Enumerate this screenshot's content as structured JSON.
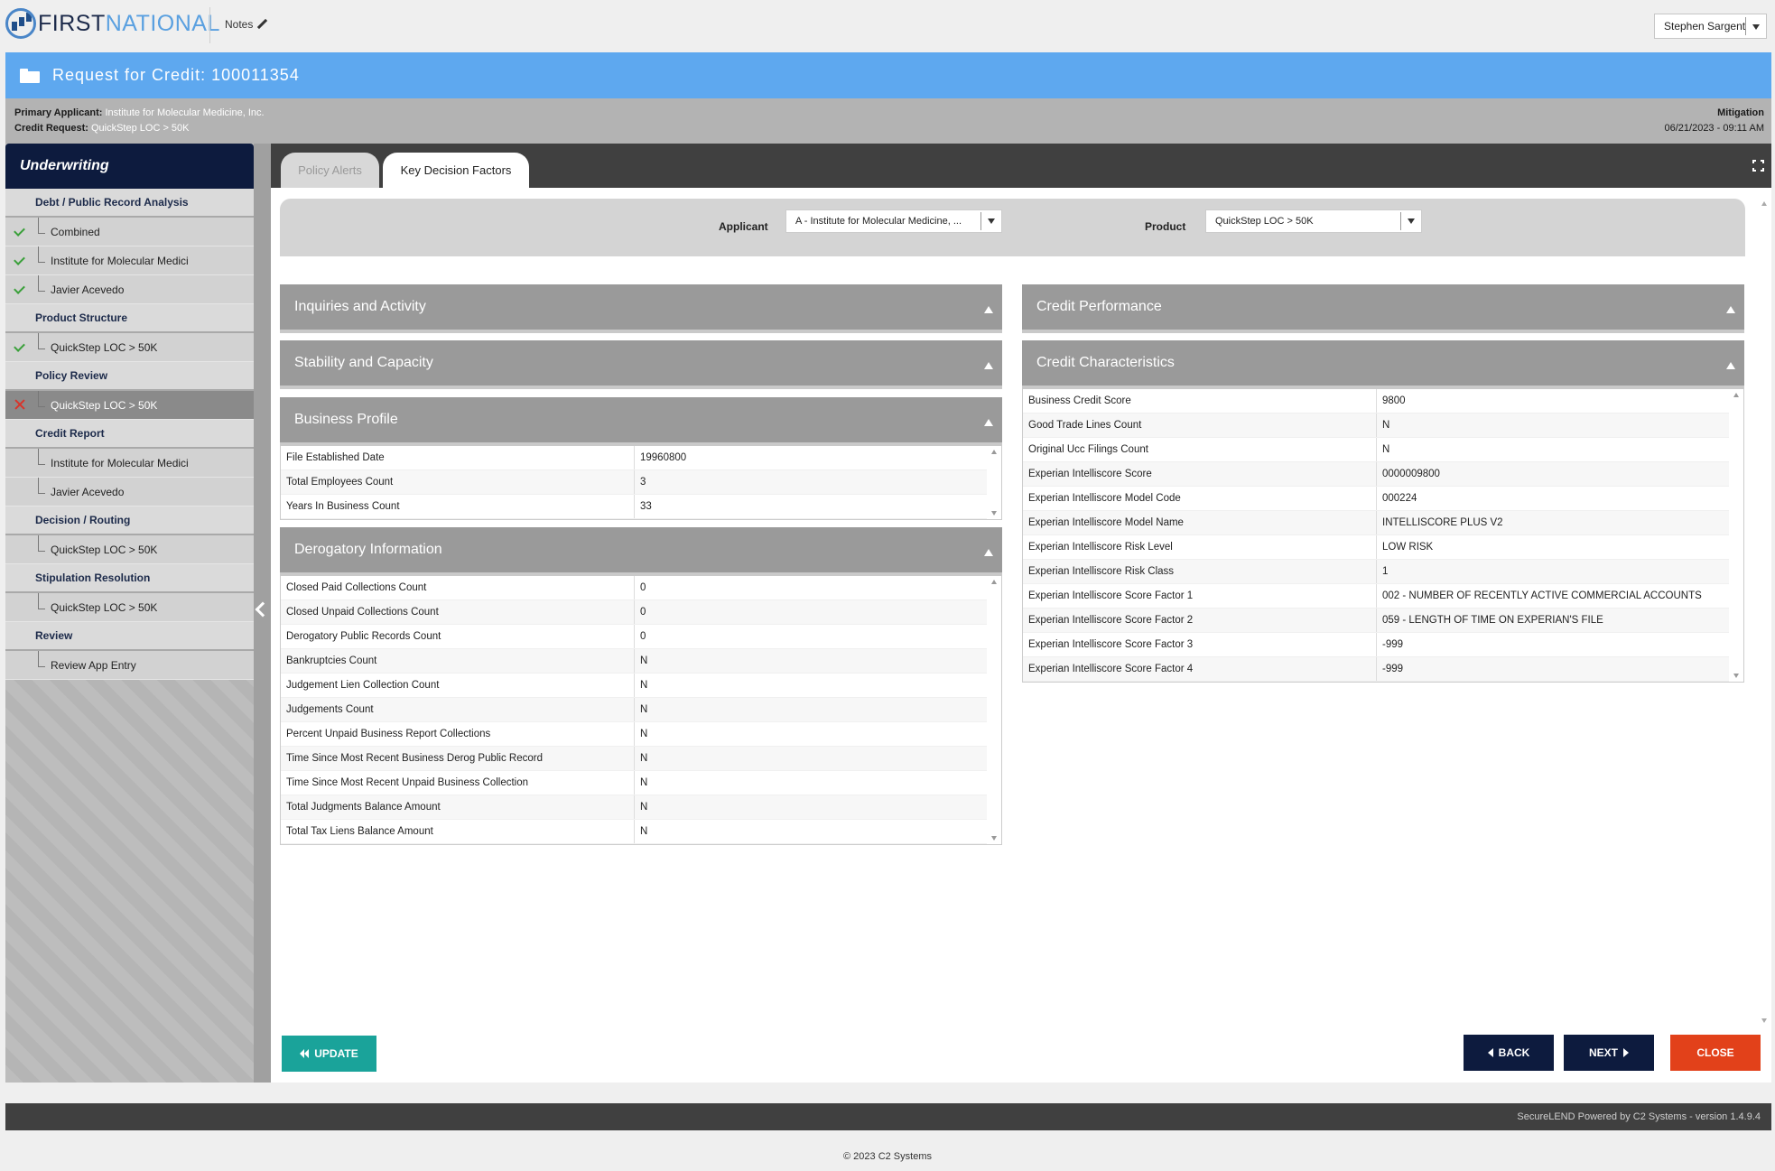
{
  "brand": {
    "first": "FIRST",
    "national": "NATIONAL"
  },
  "topbar": {
    "notes_label": "Notes",
    "user": "Stephen Sargent"
  },
  "title": "Request for Credit: 100011354",
  "info": {
    "primary_applicant_label": "Primary Applicant:",
    "primary_applicant_value": "Institute for Molecular Medicine, Inc.",
    "credit_request_label": "Credit Request:",
    "credit_request_value": "QuickStep LOC > 50K",
    "status": "Mitigation",
    "timestamp": "06/21/2023 - 09:11 AM"
  },
  "sidebar": {
    "title": "Underwriting",
    "sections": [
      {
        "label": "Debt / Public Record Analysis",
        "items": [
          {
            "label": "Combined",
            "status": "check"
          },
          {
            "label": "Institute for Molecular Medici",
            "status": "check"
          },
          {
            "label": "Javier Acevedo",
            "status": "check"
          }
        ]
      },
      {
        "label": "Product Structure",
        "items": [
          {
            "label": "QuickStep LOC > 50K",
            "status": "check"
          }
        ]
      },
      {
        "label": "Policy Review",
        "items": [
          {
            "label": "QuickStep LOC > 50K",
            "status": "x",
            "active": true
          }
        ]
      },
      {
        "label": "Credit Report",
        "items": [
          {
            "label": "Institute for Molecular Medici",
            "status": ""
          },
          {
            "label": "Javier Acevedo",
            "status": ""
          }
        ]
      },
      {
        "label": "Decision / Routing",
        "items": [
          {
            "label": "QuickStep LOC > 50K",
            "status": ""
          }
        ]
      },
      {
        "label": "Stipulation Resolution",
        "items": [
          {
            "label": "QuickStep LOC > 50K",
            "status": ""
          }
        ]
      },
      {
        "label": "Review",
        "items": [
          {
            "label": "Review App Entry",
            "status": ""
          }
        ]
      }
    ]
  },
  "tabs": {
    "policy_alerts": "Policy Alerts",
    "key_decision_factors": "Key Decision Factors"
  },
  "filters": {
    "applicant_label": "Applicant",
    "applicant_value": "A - Institute for Molecular Medicine, ...",
    "product_label": "Product",
    "product_value": "QuickStep LOC > 50K"
  },
  "sections": {
    "inquiries": "Inquiries and Activity",
    "stability": "Stability and Capacity",
    "business_profile": "Business Profile",
    "derogatory": "Derogatory Information",
    "credit_performance": "Credit Performance",
    "credit_characteristics": "Credit Characteristics"
  },
  "business_profile_rows": [
    {
      "k": "File Established Date",
      "v": "19960800"
    },
    {
      "k": "Total Employees Count",
      "v": "3"
    },
    {
      "k": "Years In Business Count",
      "v": "33"
    }
  ],
  "derogatory_rows": [
    {
      "k": "Closed Paid Collections Count",
      "v": "0"
    },
    {
      "k": "Closed Unpaid Collections Count",
      "v": "0"
    },
    {
      "k": "Derogatory Public Records Count",
      "v": "0"
    },
    {
      "k": "Bankruptcies Count",
      "v": "N"
    },
    {
      "k": "Judgement Lien Collection Count",
      "v": "N"
    },
    {
      "k": "Judgements Count",
      "v": "N"
    },
    {
      "k": "Percent Unpaid Business Report Collections",
      "v": "N"
    },
    {
      "k": "Time Since Most Recent Business Derog Public Record",
      "v": "N"
    },
    {
      "k": "Time Since Most Recent Unpaid Business Collection",
      "v": "N"
    },
    {
      "k": "Total Judgments Balance Amount",
      "v": "N"
    },
    {
      "k": "Total Tax Liens Balance Amount",
      "v": "N"
    }
  ],
  "credit_characteristics_rows": [
    {
      "k": "Business Credit Score",
      "v": "9800"
    },
    {
      "k": "Good Trade Lines Count",
      "v": "N"
    },
    {
      "k": "Original Ucc Filings Count",
      "v": "N"
    },
    {
      "k": "Experian Intelliscore Score",
      "v": "0000009800"
    },
    {
      "k": "Experian Intelliscore Model Code",
      "v": "000224"
    },
    {
      "k": "Experian Intelliscore Model Name",
      "v": "INTELLISCORE PLUS V2"
    },
    {
      "k": "Experian Intelliscore Risk Level",
      "v": "LOW RISK"
    },
    {
      "k": "Experian Intelliscore Risk Class",
      "v": "1"
    },
    {
      "k": "Experian Intelliscore Score Factor 1",
      "v": "002 - NUMBER OF RECENTLY ACTIVE COMMERCIAL ACCOUNTS"
    },
    {
      "k": "Experian Intelliscore Score Factor 2",
      "v": "059 - LENGTH OF TIME ON EXPERIAN'S FILE"
    },
    {
      "k": "Experian Intelliscore Score Factor 3",
      "v": "-999"
    },
    {
      "k": "Experian Intelliscore Score Factor 4",
      "v": "-999"
    }
  ],
  "buttons": {
    "update": "UPDATE",
    "back": "BACK",
    "next": "NEXT",
    "close": "CLOSE"
  },
  "footer": {
    "powered": "SecureLEND Powered by C2 Systems - version 1.4.9.4",
    "copyright": "© 2023 C2 Systems"
  },
  "colors": {
    "title_bar": "#5ea8ef",
    "nav_dark": "#0d1b3e",
    "update": "#1aa39a",
    "close": "#e2411a",
    "check": "#3aa03a",
    "x": "#d9342a"
  }
}
